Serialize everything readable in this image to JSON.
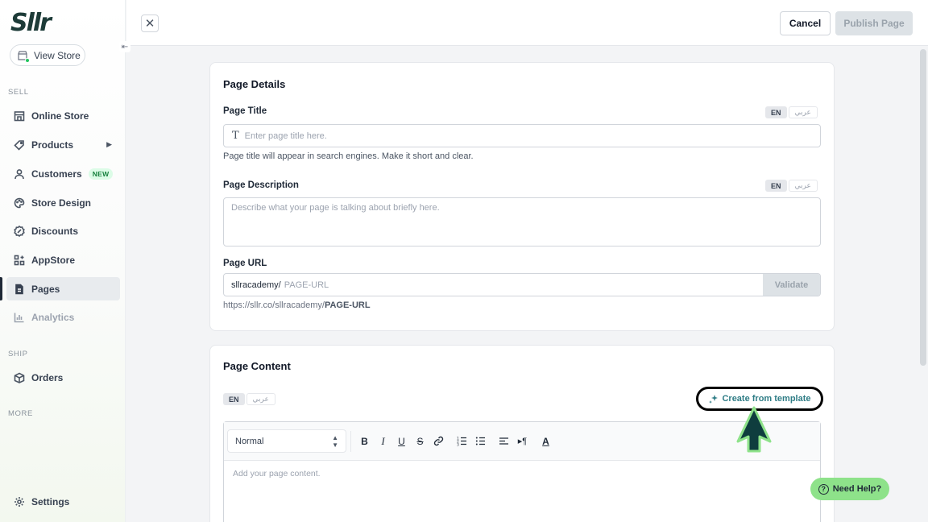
{
  "app": {
    "logo_text": "Sllr"
  },
  "sidebar": {
    "view_store": "View Store",
    "sections": {
      "sell": "SELL",
      "ship": "SHIP",
      "more": "MORE"
    },
    "items": [
      {
        "label": "Online Store",
        "icon": "store-icon"
      },
      {
        "label": "Products",
        "icon": "tag-icon"
      },
      {
        "label": "Customers",
        "icon": "user-icon",
        "badge": "NEW"
      },
      {
        "label": "Store Design",
        "icon": "palette-icon"
      },
      {
        "label": "Discounts",
        "icon": "discount-icon"
      },
      {
        "label": "AppStore",
        "icon": "apps-icon"
      },
      {
        "label": "Pages",
        "icon": "page-icon",
        "active": true
      },
      {
        "label": "Analytics",
        "icon": "chart-icon"
      },
      {
        "label": "Orders",
        "icon": "box-icon"
      }
    ],
    "settings": "Settings"
  },
  "topbar": {
    "cancel": "Cancel",
    "publish": "Publish Page"
  },
  "page_details": {
    "title": "Page Details",
    "lang_en": "EN",
    "lang_ar": "عربي",
    "page_title_label": "Page Title",
    "page_title_placeholder": "Enter page title here.",
    "page_title_helper": "Page title will appear in search engines. Make it short and clear.",
    "page_desc_label": "Page Description",
    "page_desc_placeholder": "Describe what your page is talking about briefly here.",
    "page_url_label": "Page URL",
    "url_prefix": "sllracademy/",
    "url_placeholder": "PAGE-URL",
    "validate": "Validate",
    "url_preview_base": "https://sllr.co/sllracademy/",
    "url_preview_slug": "PAGE-URL"
  },
  "page_content": {
    "title": "Page Content",
    "lang_en": "EN",
    "lang_ar": "عربي",
    "template_link": "Create from template",
    "style_select": "Normal",
    "editor_placeholder": "Add your page content."
  },
  "help": {
    "label": "Need Help?"
  },
  "colors": {
    "brand": "#1d3b38",
    "accent": "#2f7d86",
    "help_bg": "#8ee28a",
    "cursor": "#0f3d3e"
  }
}
